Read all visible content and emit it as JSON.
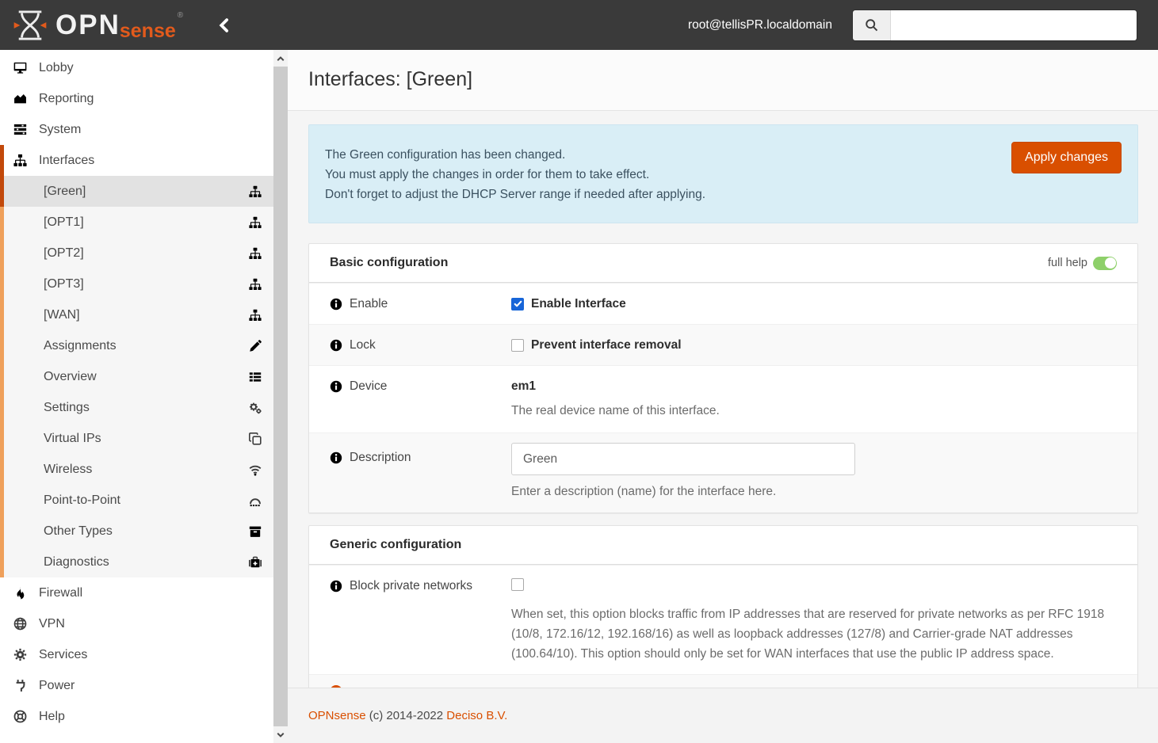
{
  "topbar": {
    "brand_opn": "OPN",
    "brand_sense": "sense",
    "brand_registered": "®",
    "user": "root@tellisPR.localdomain",
    "search_placeholder": ""
  },
  "sidebar": {
    "items": [
      {
        "label": "Lobby"
      },
      {
        "label": "Reporting"
      },
      {
        "label": "System"
      },
      {
        "label": "Interfaces"
      },
      {
        "label": "[Green]"
      },
      {
        "label": "[OPT1]"
      },
      {
        "label": "[OPT2]"
      },
      {
        "label": "[OPT3]"
      },
      {
        "label": "[WAN]"
      },
      {
        "label": "Assignments"
      },
      {
        "label": "Overview"
      },
      {
        "label": "Settings"
      },
      {
        "label": "Virtual IPs"
      },
      {
        "label": "Wireless"
      },
      {
        "label": "Point-to-Point"
      },
      {
        "label": "Other Types"
      },
      {
        "label": "Diagnostics"
      },
      {
        "label": "Firewall"
      },
      {
        "label": "VPN"
      },
      {
        "label": "Services"
      },
      {
        "label": "Power"
      },
      {
        "label": "Help"
      }
    ]
  },
  "page": {
    "title": "Interfaces: [Green]"
  },
  "alert": {
    "lines": [
      "The Green configuration has been changed.",
      "You must apply the changes in order for them to take effect.",
      "Don't forget to adjust the DHCP Server range if needed after applying."
    ],
    "apply_label": "Apply changes"
  },
  "basic": {
    "title": "Basic configuration",
    "full_help_label": "full help",
    "enable": {
      "label": "Enable",
      "checkbox_label": "Enable Interface",
      "checked": true
    },
    "lock": {
      "label": "Lock",
      "checkbox_label": "Prevent interface removal",
      "checked": false
    },
    "device": {
      "label": "Device",
      "value": "em1",
      "help": "The real device name of this interface."
    },
    "description": {
      "label": "Description",
      "value": "Green",
      "help": "Enter a description (name) for the interface here."
    }
  },
  "generic": {
    "title": "Generic configuration",
    "block_private": {
      "label": "Block private networks",
      "checked": false,
      "help": "When set, this option blocks traffic from IP addresses that are reserved for private networks as per RFC 1918 (10/8, 172.16/12, 192.168/16) as well as loopback addresses (127/8) and Carrier-grade NAT addresses (100.64/10). This option should only be set for WAN interfaces that use the public IP address space."
    }
  },
  "footer": {
    "brand_link": "OPNsense",
    "copyright": "(c) 2014-2022",
    "company_link": "Deciso B.V."
  },
  "colors": {
    "header_bg": "#3a3a3a",
    "accent_orange": "#d94f00",
    "submenu_border_orange": "#efa05b",
    "alert_bg": "#d9eef6",
    "toggle_green": "#8ed06a",
    "checkbox_blue": "#1765d8"
  }
}
